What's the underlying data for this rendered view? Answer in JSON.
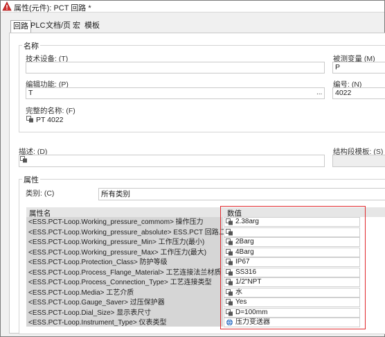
{
  "window": {
    "title": "属性(元件): PCT 回路 *"
  },
  "tabs": [
    "回路",
    "PLC",
    "文档/页",
    "宏",
    "模板"
  ],
  "name_group": {
    "title": "名称",
    "tech_equipment_label": "技术设备: (T)",
    "tech_equipment_value": "",
    "measured_variable_label": "被测变量 (M)",
    "measured_variable_value": "P",
    "edit_function_label": "编辑功能: (P)",
    "edit_function_value": "T",
    "edit_function_ellipsis": "...",
    "number_label": "编号: (N)",
    "number_value": "4022",
    "full_name_label": "完整的名称: (F)",
    "full_name_value": "PT 4022"
  },
  "description_label": "描述: (D)",
  "structure_template_label": "结构段模板: (S)",
  "props_group": {
    "title": "属性",
    "category_label": "类别: (C)",
    "category_value": "所有类别",
    "col_name": "属性名",
    "col_value": "数值",
    "rows": [
      {
        "name": "<ESS.PCT-Loop.Working_pressure_commom> 操作压力",
        "value": "2.38arg",
        "icon": "multilang-icon"
      },
      {
        "name": "<ESS.PCT-Loop.Working_pressure_absolute> ESS.PCT 回路.工作压力 (绝对)",
        "value": "",
        "icon": "multilang-icon"
      },
      {
        "name": "<ESS.PCT-Loop.Working_pressure_Min> 工作压力(最小)",
        "value": "2Barg",
        "icon": "multilang-icon"
      },
      {
        "name": "<ESS.PCT-Loop.Working_pressure_Max> 工作压力(最大)",
        "value": "4Barg",
        "icon": "multilang-icon"
      },
      {
        "name": "<ESS.PCT-Loop.Protection_Class> 防护等级",
        "value": "IP67",
        "icon": "multilang-icon"
      },
      {
        "name": "<ESS.PCT-Loop.Process_Flange_Material> 工艺连接法兰材质",
        "value": "SS316",
        "icon": "multilang-icon"
      },
      {
        "name": "<ESS.PCT-Loop.Process_Connection_Type> 工艺连接类型",
        "value": "1/2\"NPT",
        "icon": "multilang-icon"
      },
      {
        "name": "<ESS.PCT-Loop.Media> 工艺介质",
        "value": "水",
        "icon": "multilang-icon"
      },
      {
        "name": "<ESS.PCT-Loop.Gauge_Saver> 过压保护器",
        "value": "Yes",
        "icon": "multilang-icon"
      },
      {
        "name": "<ESS.PCT-Loop.Dial_Size> 显示表尺寸",
        "value": "D=100mm",
        "icon": "multilang-icon"
      },
      {
        "name": "<ESS.PCT-Loop.Instrument_Type> 仪表类型",
        "value": "压力变送器",
        "icon": "globe-lang-icon"
      }
    ]
  },
  "colors": {
    "highlight_border": "#e0262a",
    "warning_icon": "#d32f2f"
  }
}
